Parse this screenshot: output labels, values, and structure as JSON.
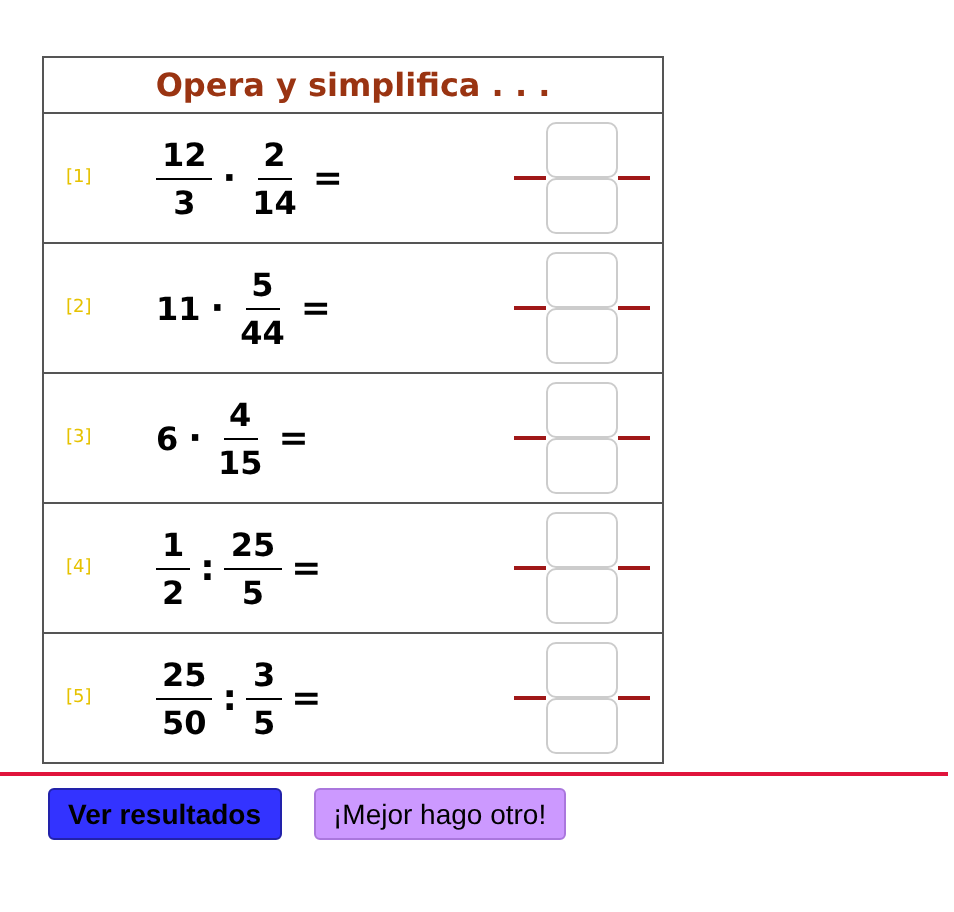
{
  "title": "Opera y simplifica . . .",
  "exercises": [
    {
      "label": "[1]",
      "terms": [
        {
          "kind": "fraction",
          "num": "12",
          "den": "3"
        },
        {
          "kind": "operator",
          "text": "·"
        },
        {
          "kind": "fraction",
          "num": "2",
          "den": "14"
        },
        {
          "kind": "operator",
          "text": "="
        }
      ]
    },
    {
      "label": "[2]",
      "terms": [
        {
          "kind": "integer",
          "text": "11"
        },
        {
          "kind": "operator",
          "text": "·"
        },
        {
          "kind": "fraction",
          "num": "5",
          "den": "44"
        },
        {
          "kind": "operator",
          "text": "="
        }
      ]
    },
    {
      "label": "[3]",
      "terms": [
        {
          "kind": "integer",
          "text": "6"
        },
        {
          "kind": "operator",
          "text": "·"
        },
        {
          "kind": "fraction",
          "num": "4",
          "den": "15"
        },
        {
          "kind": "operator",
          "text": "="
        }
      ]
    },
    {
      "label": "[4]",
      "terms": [
        {
          "kind": "fraction",
          "num": "1",
          "den": "2"
        },
        {
          "kind": "operator",
          "text": ":"
        },
        {
          "kind": "fraction",
          "num": "25",
          "den": "5"
        },
        {
          "kind": "operator",
          "text": "="
        }
      ]
    },
    {
      "label": "[5]",
      "terms": [
        {
          "kind": "fraction",
          "num": "25",
          "den": "50"
        },
        {
          "kind": "operator",
          "text": ":"
        },
        {
          "kind": "fraction",
          "num": "3",
          "den": "5"
        },
        {
          "kind": "operator",
          "text": "="
        }
      ]
    }
  ],
  "buttons": [
    {
      "label": "Ver resultados",
      "kind": "primary"
    },
    {
      "label": "¡Mejor hago otro!",
      "kind": "secondary"
    }
  ]
}
